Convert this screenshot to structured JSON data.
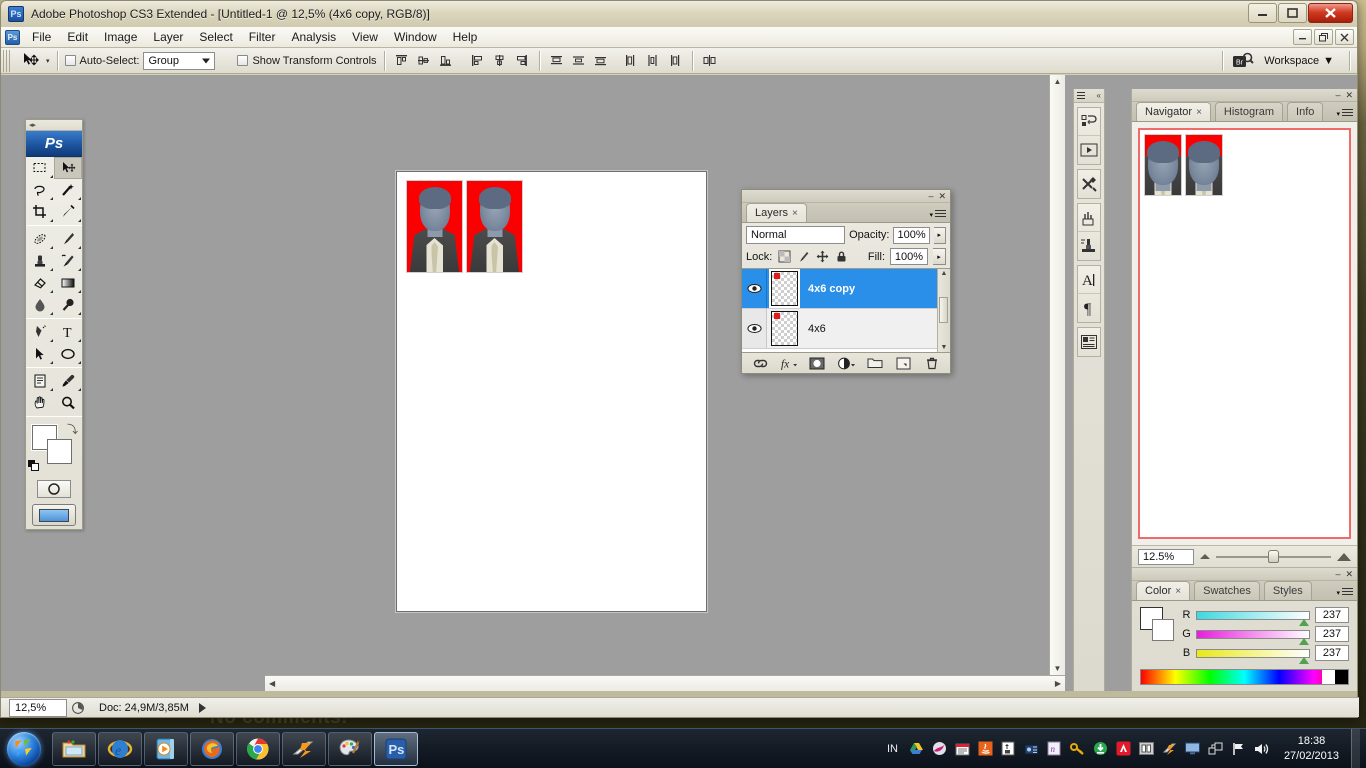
{
  "window": {
    "app_badge": "Ps",
    "title": "Adobe Photoshop CS3 Extended - [Untitled-1 @ 12,5% (4x6 copy, RGB/8)]",
    "minimize": "—",
    "maximize": "❐",
    "close": "✕"
  },
  "menu": {
    "items": [
      "File",
      "Edit",
      "Image",
      "Layer",
      "Select",
      "Filter",
      "Analysis",
      "View",
      "Window",
      "Help"
    ],
    "doc_minimize": "–",
    "doc_restore": "❐",
    "doc_close": "✕"
  },
  "options_bar": {
    "tool_name": "move-tool",
    "auto_select_label": "Auto-Select:",
    "auto_select_value": "Group",
    "show_transform_label": "Show Transform Controls",
    "workspace_label": "Workspace",
    "bridge_label": "Br",
    "align_group_1": [
      "align-top-edges",
      "align-vertical-centers",
      "align-bottom-edges"
    ],
    "align_group_2": [
      "align-left-edges",
      "align-horizontal-centers",
      "align-right-edges"
    ],
    "distribute_group_1": [
      "distribute-top-edges",
      "distribute-vertical-centers",
      "distribute-bottom-edges"
    ],
    "distribute_group_2": [
      "distribute-left-edges",
      "distribute-horizontal-centers",
      "distribute-right-edges"
    ],
    "distribute_extra": "distribute-link"
  },
  "toolbox": {
    "logo": "Ps",
    "tools": [
      "rectangular-marquee-tool",
      "move-tool",
      "lasso-tool",
      "magic-wand-tool",
      "crop-tool",
      "slice-tool",
      "healing-brush-tool",
      "brush-tool",
      "clone-stamp-tool",
      "history-brush-tool",
      "eraser-tool",
      "gradient-tool",
      "blur-tool",
      "dodge-tool",
      "pen-tool",
      "horizontal-type-tool",
      "path-selection-tool",
      "ellipse-tool",
      "notes-tool",
      "eyedropper-tool",
      "hand-tool",
      "zoom-tool"
    ],
    "foreground_color": "#ffffff",
    "background_color": "#ffffff",
    "quick_mask": "edit-in-quick-mask-mode",
    "screen_mode": "change-screen-mode"
  },
  "document": {
    "background": "#ffffff",
    "photo_count": 2,
    "photo_bg_color": "#fb0000"
  },
  "layers_panel": {
    "tab_label": "Layers",
    "tab_close": "×",
    "blend_mode": "Normal",
    "opacity_label": "Opacity:",
    "opacity_value": "100%",
    "lock_label": "Lock:",
    "fill_label": "Fill:",
    "fill_value": "100%",
    "lock_icons": [
      "lock-transparent-pixels",
      "lock-image-pixels",
      "lock-position",
      "lock-all"
    ],
    "layers": [
      {
        "name": "4x6 copy",
        "visible": true,
        "selected": true
      },
      {
        "name": "4x6",
        "visible": true,
        "selected": false
      }
    ],
    "footer_icons": [
      "link-layers",
      "add-layer-style",
      "add-layer-mask",
      "new-adjustment-layer",
      "new-group",
      "new-layer",
      "delete-layer"
    ],
    "panel_minimize": "–",
    "panel_close": "✕"
  },
  "dock_rail": {
    "collapse": "«",
    "icons": [
      "actions-panel-icon",
      "play-icon",
      "tool-presets-icon",
      "brushes-icon",
      "clone-source-icon",
      "character-panel-icon",
      "paragraph-panel-icon",
      "layer-comps-icon"
    ]
  },
  "navigator_panel": {
    "tabs": [
      "Navigator",
      "Histogram",
      "Info"
    ],
    "active_tab": "Navigator",
    "tab_close": "×",
    "zoom_value": "12.5%",
    "view_box_color": "#f06a6a",
    "panel_minimize": "–",
    "panel_close": "✕"
  },
  "color_panel": {
    "tabs": [
      "Color",
      "Swatches",
      "Styles"
    ],
    "active_tab": "Color",
    "tab_close": "×",
    "channels": [
      {
        "label": "R",
        "value": "237"
      },
      {
        "label": "G",
        "value": "237"
      },
      {
        "label": "B",
        "value": "237"
      }
    ],
    "panel_minimize": "–",
    "panel_close": "✕"
  },
  "status_bar": {
    "zoom": "12,5%",
    "doc_info": "Doc: 24,9M/3,85M",
    "arrow": "▶"
  },
  "taskbar": {
    "start": "start-orb",
    "apps": [
      {
        "name": "windows-explorer",
        "active": false
      },
      {
        "name": "internet-explorer",
        "active": false
      },
      {
        "name": "windows-media-player",
        "active": false
      },
      {
        "name": "mozilla-firefox",
        "active": false
      },
      {
        "name": "google-chrome",
        "active": false
      },
      {
        "name": "winamp",
        "active": false
      },
      {
        "name": "microsoft-paint",
        "active": false
      },
      {
        "name": "adobe-photoshop",
        "active": true
      }
    ],
    "language": "IN",
    "tray_icons": [
      "google-drive",
      "nero",
      "calendar",
      "java-update",
      "usb-eject",
      "network-adapter",
      "notepad-app",
      "keyfinder",
      "idm",
      "avira-antivirus",
      "directx",
      "winamp-agent",
      "display",
      "network",
      "action-center-flag",
      "volume"
    ],
    "time": "18:38",
    "date": "27/02/2013"
  },
  "desktop": {
    "text": "No comments!"
  }
}
